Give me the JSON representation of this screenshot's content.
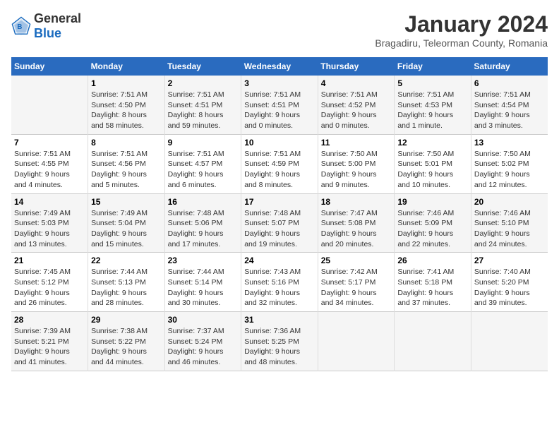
{
  "header": {
    "logo_general": "General",
    "logo_blue": "Blue",
    "title": "January 2024",
    "subtitle": "Bragadiru, Teleorman County, Romania"
  },
  "weekdays": [
    "Sunday",
    "Monday",
    "Tuesday",
    "Wednesday",
    "Thursday",
    "Friday",
    "Saturday"
  ],
  "weeks": [
    [
      {
        "day": "",
        "info": ""
      },
      {
        "day": "1",
        "info": "Sunrise: 7:51 AM\nSunset: 4:50 PM\nDaylight: 8 hours\nand 58 minutes."
      },
      {
        "day": "2",
        "info": "Sunrise: 7:51 AM\nSunset: 4:51 PM\nDaylight: 8 hours\nand 59 minutes."
      },
      {
        "day": "3",
        "info": "Sunrise: 7:51 AM\nSunset: 4:51 PM\nDaylight: 9 hours\nand 0 minutes."
      },
      {
        "day": "4",
        "info": "Sunrise: 7:51 AM\nSunset: 4:52 PM\nDaylight: 9 hours\nand 0 minutes."
      },
      {
        "day": "5",
        "info": "Sunrise: 7:51 AM\nSunset: 4:53 PM\nDaylight: 9 hours\nand 1 minute."
      },
      {
        "day": "6",
        "info": "Sunrise: 7:51 AM\nSunset: 4:54 PM\nDaylight: 9 hours\nand 3 minutes."
      }
    ],
    [
      {
        "day": "7",
        "info": "Sunrise: 7:51 AM\nSunset: 4:55 PM\nDaylight: 9 hours\nand 4 minutes."
      },
      {
        "day": "8",
        "info": "Sunrise: 7:51 AM\nSunset: 4:56 PM\nDaylight: 9 hours\nand 5 minutes."
      },
      {
        "day": "9",
        "info": "Sunrise: 7:51 AM\nSunset: 4:57 PM\nDaylight: 9 hours\nand 6 minutes."
      },
      {
        "day": "10",
        "info": "Sunrise: 7:51 AM\nSunset: 4:59 PM\nDaylight: 9 hours\nand 8 minutes."
      },
      {
        "day": "11",
        "info": "Sunrise: 7:50 AM\nSunset: 5:00 PM\nDaylight: 9 hours\nand 9 minutes."
      },
      {
        "day": "12",
        "info": "Sunrise: 7:50 AM\nSunset: 5:01 PM\nDaylight: 9 hours\nand 10 minutes."
      },
      {
        "day": "13",
        "info": "Sunrise: 7:50 AM\nSunset: 5:02 PM\nDaylight: 9 hours\nand 12 minutes."
      }
    ],
    [
      {
        "day": "14",
        "info": "Sunrise: 7:49 AM\nSunset: 5:03 PM\nDaylight: 9 hours\nand 13 minutes."
      },
      {
        "day": "15",
        "info": "Sunrise: 7:49 AM\nSunset: 5:04 PM\nDaylight: 9 hours\nand 15 minutes."
      },
      {
        "day": "16",
        "info": "Sunrise: 7:48 AM\nSunset: 5:06 PM\nDaylight: 9 hours\nand 17 minutes."
      },
      {
        "day": "17",
        "info": "Sunrise: 7:48 AM\nSunset: 5:07 PM\nDaylight: 9 hours\nand 19 minutes."
      },
      {
        "day": "18",
        "info": "Sunrise: 7:47 AM\nSunset: 5:08 PM\nDaylight: 9 hours\nand 20 minutes."
      },
      {
        "day": "19",
        "info": "Sunrise: 7:46 AM\nSunset: 5:09 PM\nDaylight: 9 hours\nand 22 minutes."
      },
      {
        "day": "20",
        "info": "Sunrise: 7:46 AM\nSunset: 5:10 PM\nDaylight: 9 hours\nand 24 minutes."
      }
    ],
    [
      {
        "day": "21",
        "info": "Sunrise: 7:45 AM\nSunset: 5:12 PM\nDaylight: 9 hours\nand 26 minutes."
      },
      {
        "day": "22",
        "info": "Sunrise: 7:44 AM\nSunset: 5:13 PM\nDaylight: 9 hours\nand 28 minutes."
      },
      {
        "day": "23",
        "info": "Sunrise: 7:44 AM\nSunset: 5:14 PM\nDaylight: 9 hours\nand 30 minutes."
      },
      {
        "day": "24",
        "info": "Sunrise: 7:43 AM\nSunset: 5:16 PM\nDaylight: 9 hours\nand 32 minutes."
      },
      {
        "day": "25",
        "info": "Sunrise: 7:42 AM\nSunset: 5:17 PM\nDaylight: 9 hours\nand 34 minutes."
      },
      {
        "day": "26",
        "info": "Sunrise: 7:41 AM\nSunset: 5:18 PM\nDaylight: 9 hours\nand 37 minutes."
      },
      {
        "day": "27",
        "info": "Sunrise: 7:40 AM\nSunset: 5:20 PM\nDaylight: 9 hours\nand 39 minutes."
      }
    ],
    [
      {
        "day": "28",
        "info": "Sunrise: 7:39 AM\nSunset: 5:21 PM\nDaylight: 9 hours\nand 41 minutes."
      },
      {
        "day": "29",
        "info": "Sunrise: 7:38 AM\nSunset: 5:22 PM\nDaylight: 9 hours\nand 44 minutes."
      },
      {
        "day": "30",
        "info": "Sunrise: 7:37 AM\nSunset: 5:24 PM\nDaylight: 9 hours\nand 46 minutes."
      },
      {
        "day": "31",
        "info": "Sunrise: 7:36 AM\nSunset: 5:25 PM\nDaylight: 9 hours\nand 48 minutes."
      },
      {
        "day": "",
        "info": ""
      },
      {
        "day": "",
        "info": ""
      },
      {
        "day": "",
        "info": ""
      }
    ]
  ]
}
